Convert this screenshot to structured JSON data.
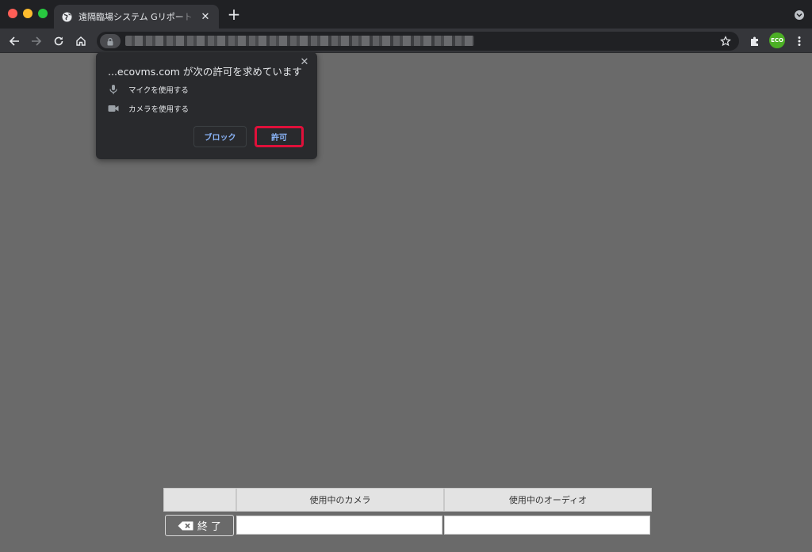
{
  "browser": {
    "tab_title": "遠隔臨場システム Gリポート L | PC",
    "profile_label": "ECO",
    "url": "",
    "colors": {
      "frame": "#202124",
      "toolbar": "#35363a",
      "accent": "#8ab4f8",
      "highlight": "#e0103a"
    }
  },
  "permission_prompt": {
    "title": "...ecovms.com が次の許可を求めています",
    "permissions": [
      {
        "icon": "microphone-icon",
        "label": "マイクを使用する"
      },
      {
        "icon": "camera-icon",
        "label": "カメラを使用する"
      }
    ],
    "block_label": "ブロック",
    "allow_label": "許可"
  },
  "controls": {
    "camera_header": "使用中のカメラ",
    "audio_header": "使用中のオーディオ",
    "exit_label": "終 了",
    "camera_value": "",
    "audio_value": ""
  }
}
